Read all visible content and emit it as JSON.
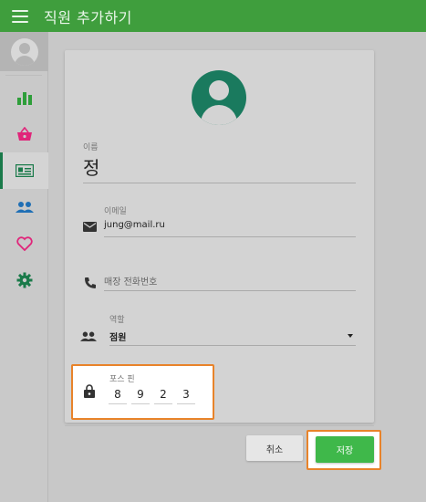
{
  "header": {
    "title": "직원 추가하기",
    "menu_icon": "hamburger-menu-icon"
  },
  "sidebar": {
    "avatar_icon": "user-avatar-icon",
    "items": [
      {
        "icon": "bar-chart-icon",
        "color": "#2e9e3a",
        "active": false
      },
      {
        "icon": "shopping-basket-icon",
        "color": "#e0257a",
        "active": false
      },
      {
        "icon": "id-card-icon",
        "color": "#1a7a4a",
        "active": true
      },
      {
        "icon": "people-icon",
        "color": "#1f6fb5",
        "active": false
      },
      {
        "icon": "heart-icon",
        "color": "#e0257a",
        "active": false
      },
      {
        "icon": "settings-gear-icon",
        "color": "#1a7a4a",
        "active": false
      }
    ]
  },
  "form": {
    "avatar_color": "#1a7a5e",
    "name": {
      "label": "이름",
      "value": "정"
    },
    "email": {
      "label": "이메일",
      "value": "jung@mail.ru",
      "icon": "mail-icon"
    },
    "phone": {
      "placeholder": "매장 전화번호",
      "icon": "phone-icon"
    },
    "role": {
      "label": "역할",
      "value": "점원",
      "icon": "people-icon"
    },
    "pos_pin": {
      "label": "포스 핀",
      "digits": [
        "8",
        "9",
        "2",
        "3"
      ],
      "icon": "lock-icon"
    }
  },
  "actions": {
    "cancel_label": "취소",
    "save_label": "저장"
  },
  "colors": {
    "header": "#3f9e3d",
    "highlight": "#e8832a",
    "save_button": "#3fb84a"
  }
}
